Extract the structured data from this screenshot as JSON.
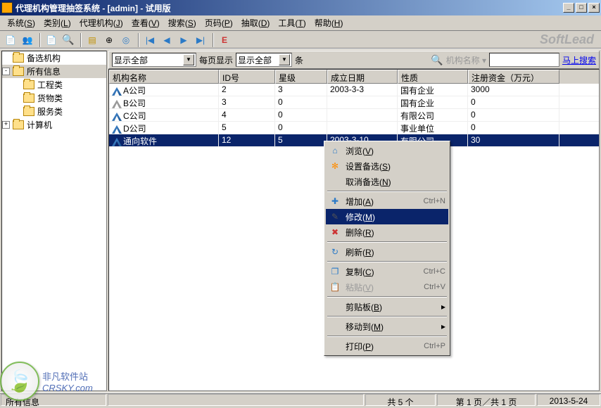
{
  "title": "代理机构管理抽签系统 - [admin] - 试用版",
  "menus": [
    "系统(S)",
    "类别(L)",
    "代理机构(J)",
    "查看(V)",
    "搜索(S)",
    "页码(P)",
    "抽取(D)",
    "工具(T)",
    "帮助(H)"
  ],
  "brand": "SoftLead",
  "filter": {
    "showall": "显示全部",
    "perpage": "每页显示",
    "showall2": "显示全部",
    "tiao": "条",
    "searchlabel": "机构名称",
    "searchnow": "马上搜索"
  },
  "tree": [
    {
      "lvl": 0,
      "exp": "",
      "label": "备选机构"
    },
    {
      "lvl": 0,
      "exp": "-",
      "label": "所有信息",
      "sel": true
    },
    {
      "lvl": 1,
      "exp": "",
      "label": "工程类"
    },
    {
      "lvl": 1,
      "exp": "",
      "label": "货物类"
    },
    {
      "lvl": 1,
      "exp": "",
      "label": "服务类"
    },
    {
      "lvl": 0,
      "exp": "+",
      "label": "计算机"
    }
  ],
  "columns": [
    "机构名称",
    "ID号",
    "星级",
    "成立日期",
    "性质",
    "注册资金（万元）"
  ],
  "rows": [
    {
      "ic": "b",
      "c": [
        "A公司",
        "2",
        "3",
        "2003-3-3",
        "国有企业",
        "3000"
      ]
    },
    {
      "ic": "g",
      "c": [
        "B公司",
        "3",
        "0",
        "",
        "国有企业",
        "0"
      ]
    },
    {
      "ic": "b",
      "c": [
        "C公司",
        "4",
        "0",
        "",
        "有限公司",
        "0"
      ]
    },
    {
      "ic": "b",
      "c": [
        "D公司",
        "5",
        "0",
        "",
        "事业单位",
        "0"
      ]
    },
    {
      "ic": "b",
      "c": [
        "通向软件",
        "12",
        "5",
        "2003-3-10",
        "有限公司",
        "30"
      ],
      "sel": true
    }
  ],
  "ctxmenu": [
    {
      "icon": "⌂",
      "color": "#2b7ac7",
      "label": "浏览(V)"
    },
    {
      "icon": "✻",
      "color": "#ff8c00",
      "label": "设置备选(S)"
    },
    {
      "icon": "",
      "label": "取消备选(N)"
    },
    {
      "sep": true
    },
    {
      "icon": "✚",
      "color": "#2b7ac7",
      "label": "增加(A)",
      "sc": "Ctrl+N"
    },
    {
      "icon": "✎",
      "color": "#555",
      "label": "修改(M)",
      "hl": true
    },
    {
      "icon": "✖",
      "color": "#c33",
      "label": "删除(R)..."
    },
    {
      "sep": true
    },
    {
      "icon": "↻",
      "color": "#2b7ac7",
      "label": "刷新(R)"
    },
    {
      "sep": true
    },
    {
      "icon": "❐",
      "color": "#2b7ac7",
      "label": "复制(C)",
      "sc": "Ctrl+C"
    },
    {
      "icon": "📋",
      "color": "#999",
      "label": "粘贴(V)",
      "sc": "Ctrl+V",
      "dis": true
    },
    {
      "sep": true
    },
    {
      "icon": "",
      "label": "剪贴板(B)",
      "arrow": true
    },
    {
      "sep": true
    },
    {
      "icon": "",
      "label": "移动到(M)",
      "arrow": true
    },
    {
      "sep": true
    },
    {
      "icon": "",
      "label": "打印(P)...",
      "sc": "Ctrl+P"
    }
  ],
  "status": {
    "left": "所有信息",
    "count": "共 5 个",
    "page": "第 1 页／共 1 页",
    "date": "2013-5-24"
  },
  "wm": {
    "txt": "非凡软件站",
    "sub": "CRSKY.com"
  }
}
